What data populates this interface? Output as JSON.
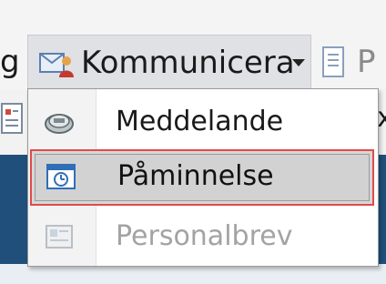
{
  "toolbar": {
    "left_partial_text": "g",
    "communicate_label": "Kommunicera",
    "right_partial_text": "P",
    "communicate_icon": "communicate-icon",
    "next_icon": "document-icon"
  },
  "background": {
    "left_partial_icon": "document-icon",
    "right_partial_char": "x"
  },
  "menu": {
    "items": [
      {
        "label": "Meddelande",
        "icon": "message-icon",
        "enabled": true,
        "selected": false
      },
      {
        "label": "Påminnelse",
        "icon": "reminder-clock-icon",
        "enabled": true,
        "selected": true
      },
      {
        "label": "Personalbrev",
        "icon": "letter-icon",
        "enabled": false,
        "selected": false
      }
    ]
  },
  "colors": {
    "highlight_border": "#e24a4a",
    "selected_bg": "#d7d7d7",
    "disabled_text": "#a3a3a3",
    "dark_band": "#1f4f7a"
  }
}
